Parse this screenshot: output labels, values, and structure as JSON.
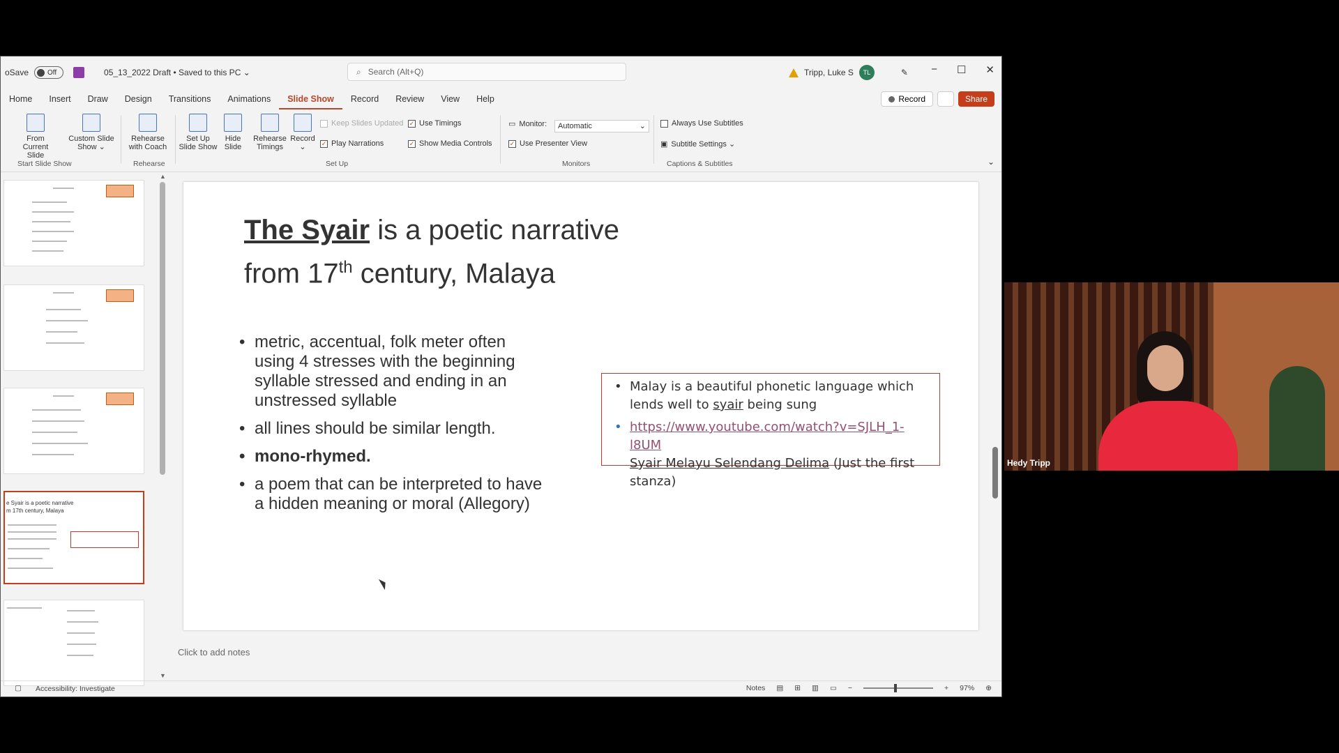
{
  "titlebar": {
    "autosave_label": "oSave",
    "autosave_state": "Off",
    "filename": "05_13_2022 Draft • Saved to this PC ⌄",
    "search_placeholder": "Search (Alt+Q)",
    "user_name": "Tripp, Luke S",
    "user_initials": "TL"
  },
  "menu": {
    "tabs": [
      "Home",
      "Insert",
      "Draw",
      "Design",
      "Transitions",
      "Animations",
      "Slide Show",
      "Record",
      "Review",
      "View",
      "Help"
    ],
    "active_tab": "Slide Show",
    "record_label": "Record",
    "share_label": "Share"
  },
  "ribbon": {
    "from_current_slide": "From\nCurrent Slide",
    "custom_slide_show": "Custom Slide\nShow ⌄",
    "rehearse_with_coach": "Rehearse\nwith Coach",
    "set_up_slide_show": "Set Up\nSlide Show",
    "hide_slide": "Hide\nSlide",
    "rehearse_timings": "Rehearse\nTimings",
    "record": "Record\n⌄",
    "keep_slides_updated": "Keep Slides Updated",
    "play_narrations": "Play Narrations",
    "use_timings": "Use Timings",
    "show_media_controls": "Show Media Controls",
    "monitor_label": "Monitor:",
    "monitor_value": "Automatic",
    "use_presenter_view": "Use Presenter View",
    "always_use_subtitles": "Always Use Subtitles",
    "subtitle_settings": "Subtitle Settings ⌄",
    "group_start": "Start Slide Show",
    "group_rehearse": "Rehearse",
    "group_setup": "Set Up",
    "group_monitors": "Monitors",
    "group_captions": "Captions & Subtitles"
  },
  "thumbnail_selected": {
    "title_line1": "e Syair is a poetic narrative",
    "title_line2": "m 17th century, Malaya"
  },
  "slide": {
    "title_bold": "The Syair",
    "title_rest1": " is a poetic narrative",
    "title_line2_a": "from 17",
    "title_sup": "th",
    "title_line2_b": " century, Malaya",
    "bullets": [
      "metric, accentual, folk meter often using 4 stresses with the beginning syllable stressed and ending in an unstressed syllable",
      "all lines should be similar length.",
      "mono-rhymed.",
      "a poem that can be interpreted to have a hidden meaning or moral (Allegory)"
    ],
    "box_line1": "Malay is a beautiful phonetic language which lends well to ",
    "box_line1_u": "syair",
    "box_line1_end": " being sung",
    "box_link": "https://www.youtube.com/watch?v=SJLH_1-l8UM",
    "box_song": "Syair Melayu Selendang Delima",
    "box_note": " (Just the first stanza)"
  },
  "notes_placeholder": "Click to add notes",
  "status": {
    "accessibility": "Accessibility: Investigate",
    "notes": "Notes",
    "zoom": "97%"
  },
  "webcam": {
    "name": "Hedy Tripp"
  }
}
